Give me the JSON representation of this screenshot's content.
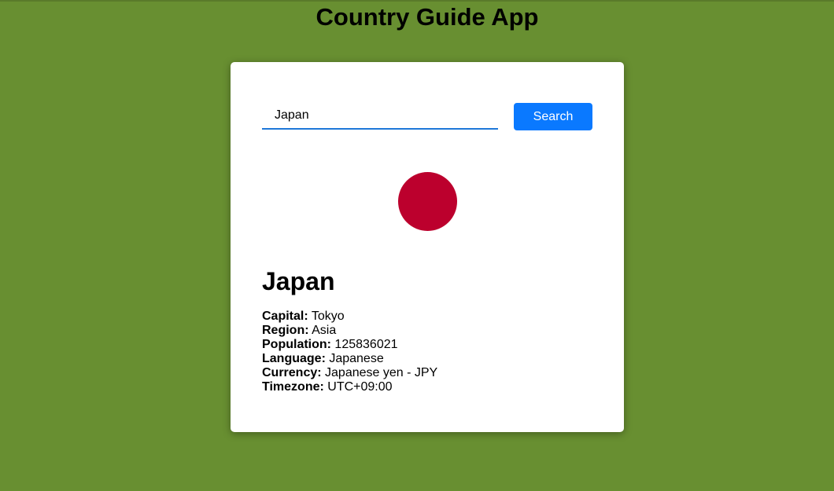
{
  "app": {
    "title": "Country Guide App"
  },
  "search": {
    "value": "Japan",
    "button_label": "Search"
  },
  "flag": {
    "color": "#bc002d"
  },
  "country": {
    "name": "Japan",
    "details": [
      {
        "label": "Capital:",
        "value": " Tokyo"
      },
      {
        "label": "Region:",
        "value": " Asia"
      },
      {
        "label": "Population:",
        "value": " 125836021"
      },
      {
        "label": "Language:",
        "value": " Japanese"
      },
      {
        "label": "Currency:",
        "value": " Japanese yen - JPY"
      },
      {
        "label": "Timezone:",
        "value": " UTC+09:00"
      }
    ]
  },
  "colors": {
    "background": "#688f31",
    "accent": "#0a79ff",
    "input_underline": "#1e78d8"
  }
}
